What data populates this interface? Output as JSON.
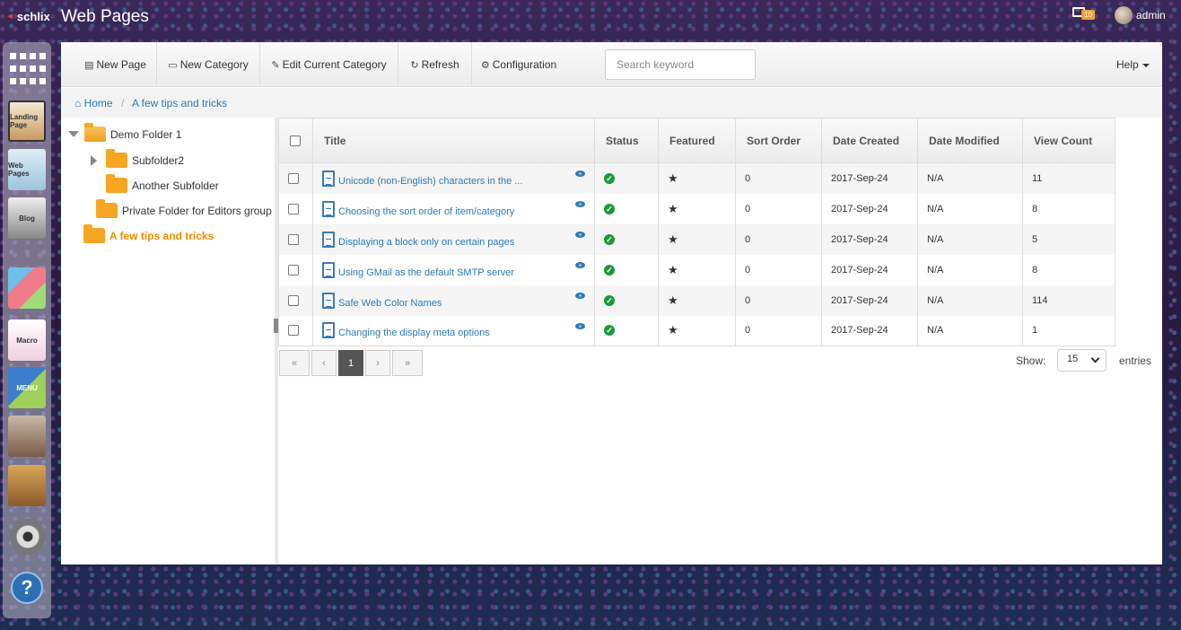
{
  "app": {
    "brand": "schlix",
    "title": "Web Pages",
    "notification_count": "10",
    "user": "admin"
  },
  "dock": [
    "Landing Page",
    "Web Pages",
    "Blog",
    "Cube",
    "Macro",
    "Menu",
    "Users",
    "Tools",
    "Settings",
    "Help"
  ],
  "dock_labels": {
    "landing": "Landing Page",
    "web": "Web Pages",
    "blog": "Blog",
    "macro": "Macro",
    "menu": "MENU"
  },
  "toolbar": {
    "new_page": "New Page",
    "new_category": "New Category",
    "edit_category": "Edit Current Category",
    "refresh": "Refresh",
    "configuration": "Configuration",
    "search_placeholder": "Search keyword",
    "help": "Help"
  },
  "breadcrumb": {
    "home": "Home",
    "current": "A few tips and tricks"
  },
  "tree": {
    "demo_folder": "Demo Folder 1",
    "subfolder2": "Subfolder2",
    "another_subfolder": "Another Subfolder",
    "private_folder": "Private Folder for Editors group",
    "tips": "A few tips and tricks"
  },
  "table": {
    "columns": [
      "Title",
      "Status",
      "Featured",
      "Sort Order",
      "Date Created",
      "Date Modified",
      "View Count"
    ],
    "rows": [
      {
        "title": "Unicode (non-English) characters in the ...",
        "sort": "0",
        "created": "2017-Sep-24",
        "modified": "N/A",
        "views": "11"
      },
      {
        "title": "Choosing the sort order of item/category",
        "sort": "0",
        "created": "2017-Sep-24",
        "modified": "N/A",
        "views": "8"
      },
      {
        "title": "Displaying a block only on certain pages",
        "sort": "0",
        "created": "2017-Sep-24",
        "modified": "N/A",
        "views": "5"
      },
      {
        "title": "Using GMail as the default SMTP server",
        "sort": "0",
        "created": "2017-Sep-24",
        "modified": "N/A",
        "views": "8"
      },
      {
        "title": "Safe Web Color Names",
        "sort": "0",
        "created": "2017-Sep-24",
        "modified": "N/A",
        "views": "114"
      },
      {
        "title": "Changing the display meta options",
        "sort": "0",
        "created": "2017-Sep-24",
        "modified": "N/A",
        "views": "1"
      }
    ]
  },
  "pager": {
    "first": "«",
    "prev": "‹",
    "page": "1",
    "next": "›",
    "last": "»",
    "show_label": "Show:",
    "page_size": "15",
    "entries_label": "entries"
  },
  "colors": {
    "link": "#2a7ab8",
    "active_folder": "#f28c00",
    "status_ok": "#1a9a3a",
    "folder": "#f6a623"
  }
}
